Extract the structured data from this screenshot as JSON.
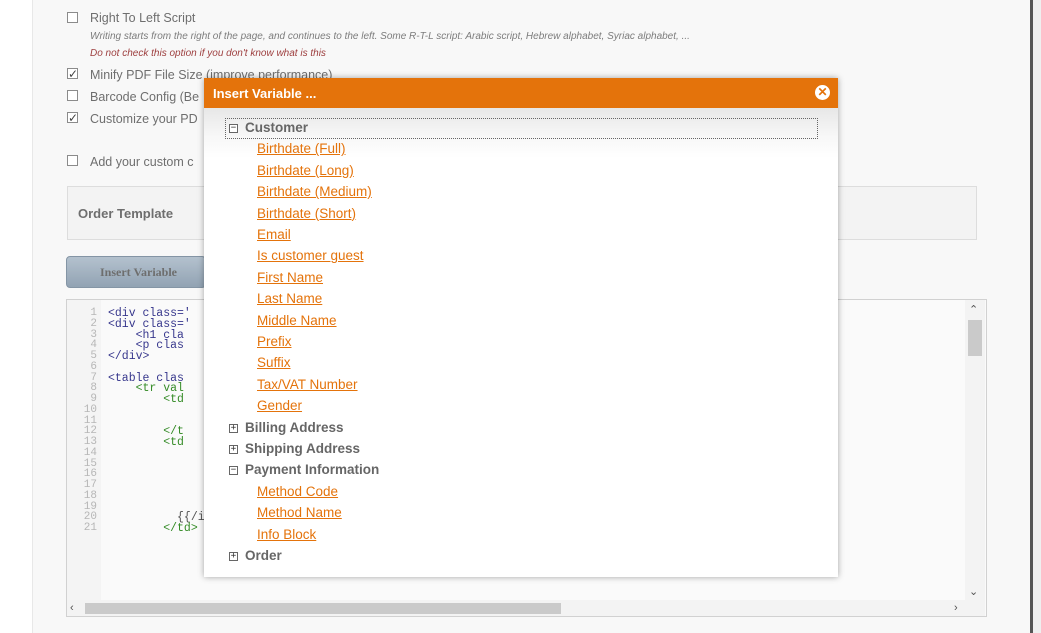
{
  "background": {
    "options": [
      {
        "label": "Right To Left Script",
        "checked": false,
        "desc": "Writing starts from the right of the page, and continues to the left. Some R-T-L script: Arabic script, Hebrew alphabet, Syriac alphabet, ...",
        "warning": "Do not check this option if you don't know what is this"
      },
      {
        "label": "Minify PDF File Size (improve performance)",
        "checked": true
      },
      {
        "label": "Barcode Config (Be",
        "checked": false
      },
      {
        "label": "Customize your PD",
        "checked": true
      },
      {
        "label": "Add your custom c",
        "checked": false
      }
    ],
    "template_label": "Order Template",
    "insert_button": "Insert Variable",
    "code_lines": [
      {
        "n": "1",
        "t": "<div class='"
      },
      {
        "n": "2",
        "t": "<div class='"
      },
      {
        "n": "3",
        "t": "    <h1 cla"
      },
      {
        "n": "4",
        "t": "    <p clas"
      },
      {
        "n": "5",
        "t": "</div>"
      },
      {
        "n": "6",
        "t": ""
      },
      {
        "n": "7",
        "t": "<table clas"
      },
      {
        "n": "8",
        "t": "    <tr val"
      },
      {
        "n": "9",
        "t": "        <td"
      },
      {
        "n": "10",
        "t": ""
      },
      {
        "n": "11",
        "t": ""
      },
      {
        "n": "12",
        "t": "        </t"
      },
      {
        "n": "13",
        "t": "        <td"
      },
      {
        "n": "14",
        "t": ""
      },
      {
        "n": "15",
        "t": ""
      },
      {
        "n": "16",
        "t": ""
      },
      {
        "n": "17",
        "t": ""
      },
      {
        "n": "18",
        "t": ""
      },
      {
        "n": "19",
        "t": ""
      },
      {
        "n": "20",
        "t": "          {{/if}}"
      },
      {
        "n": "21",
        "t": "        </td>"
      }
    ]
  },
  "modal": {
    "title": "Insert Variable ...",
    "close_icon": "close-circle-icon",
    "accent": "#e4730b",
    "tree": [
      {
        "label": "Customer",
        "expanded": true,
        "children": [
          "Birthdate (Full)",
          "Birthdate (Long)",
          "Birthdate (Medium)",
          "Birthdate (Short)",
          "Email",
          "Is customer guest",
          "First Name",
          "Last Name",
          "Middle Name",
          "Prefix",
          "Suffix",
          "Tax/VAT Number",
          "Gender"
        ]
      },
      {
        "label": "Billing Address",
        "expanded": false,
        "children": []
      },
      {
        "label": "Shipping Address",
        "expanded": false,
        "children": []
      },
      {
        "label": "Payment Information",
        "expanded": true,
        "children": [
          "Method Code",
          "Method Name",
          "Info Block"
        ]
      },
      {
        "label": "Order",
        "expanded": false,
        "children": []
      }
    ]
  }
}
